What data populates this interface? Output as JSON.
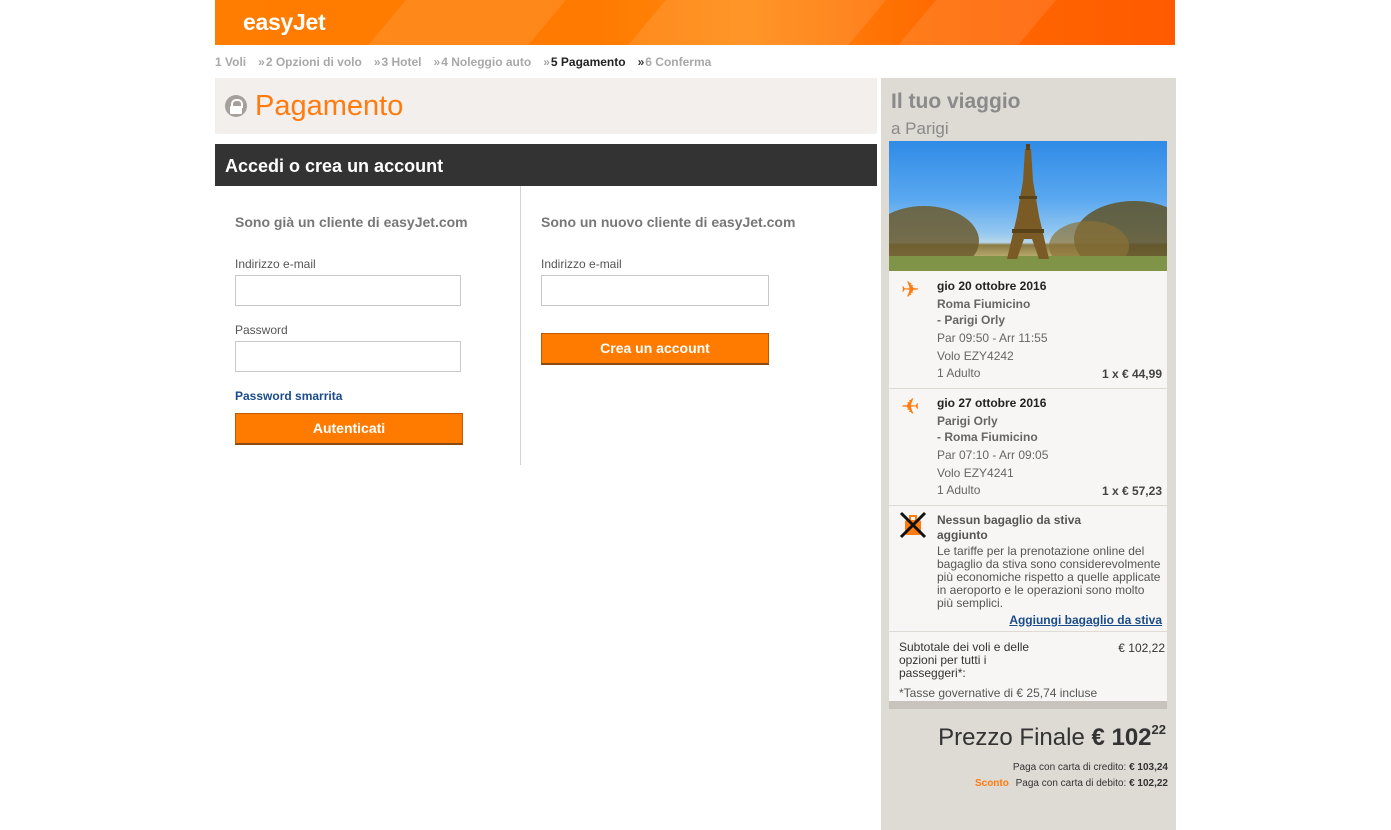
{
  "brand": {
    "logo": "easyJet"
  },
  "steps": [
    {
      "label": "1 Voli",
      "state": "done"
    },
    {
      "label": "2 Opzioni di volo",
      "state": "done"
    },
    {
      "label": "3 Hotel",
      "state": "done"
    },
    {
      "label": "4 Noleggio auto",
      "state": "done"
    },
    {
      "label": "5 Pagamento",
      "state": "current"
    },
    {
      "label": "6 Conferma",
      "state": "todo"
    }
  ],
  "page": {
    "title": "Pagamento",
    "section_title": "Accedi o crea un account"
  },
  "login": {
    "heading": "Sono già un cliente di easyJet.com",
    "email_label": "Indirizzo e-mail",
    "email_value": "",
    "password_label": "Password",
    "password_value": "",
    "forgot_link": "Password smarrita",
    "submit": "Autenticati"
  },
  "register": {
    "heading": "Sono un nuovo cliente di easyJet.com",
    "email_label": "Indirizzo e-mail",
    "email_value": "",
    "submit": "Crea un account"
  },
  "trip": {
    "title": "Il tuo viaggio",
    "destination": "a Parigi",
    "outbound": {
      "date": "gio 20 ottobre 2016",
      "from": "Roma Fiumicino",
      "to": "- Parigi Orly",
      "times": "Par 09:50 - Arr 11:55",
      "flight": "Volo EZY4242",
      "pax": "1 Adulto",
      "price": "1 x € 44,99"
    },
    "return": {
      "date": "gio 27 ottobre 2016",
      "from": "Parigi Orly",
      "to": "- Roma Fiumicino",
      "times": "Par 07:10 - Arr 09:05",
      "flight": "Volo EZY4241",
      "pax": "1 Adulto",
      "price": "1 x € 57,23"
    },
    "baggage": {
      "title": "Nessun bagaglio da stiva aggiunto",
      "text": "Le tariffe per la prenotazione online del bagaglio da stiva sono considerevolmente più economiche rispetto a quelle applicate in aeroporto e le operazioni sono molto più semplici.",
      "link": "Aggiungi bagaglio da stiva"
    },
    "subtotal_label": "Subtotale dei voli e delle opzioni per tutti i passeggeri*:",
    "subtotal_value": "€ 102,22",
    "taxes": "*Tasse governative di € 25,74 incluse",
    "final_label": "Prezzo Finale",
    "final_amount": "€ 102",
    "final_cents": "22",
    "credit_label": "Paga con carta di credito:",
    "credit_value": "€ 103,24",
    "discount_tag": "Sconto",
    "debit_label": "Paga con carta di debito:",
    "debit_value": "€ 102,22"
  },
  "colors": {
    "brand_orange": "#ff7b00",
    "dark_bar": "#333333",
    "link_blue": "#1a4b8a"
  },
  "icons": [
    "lock-icon",
    "plane-outbound-icon",
    "plane-return-icon",
    "no-baggage-icon",
    "chevron-double-icon"
  ]
}
